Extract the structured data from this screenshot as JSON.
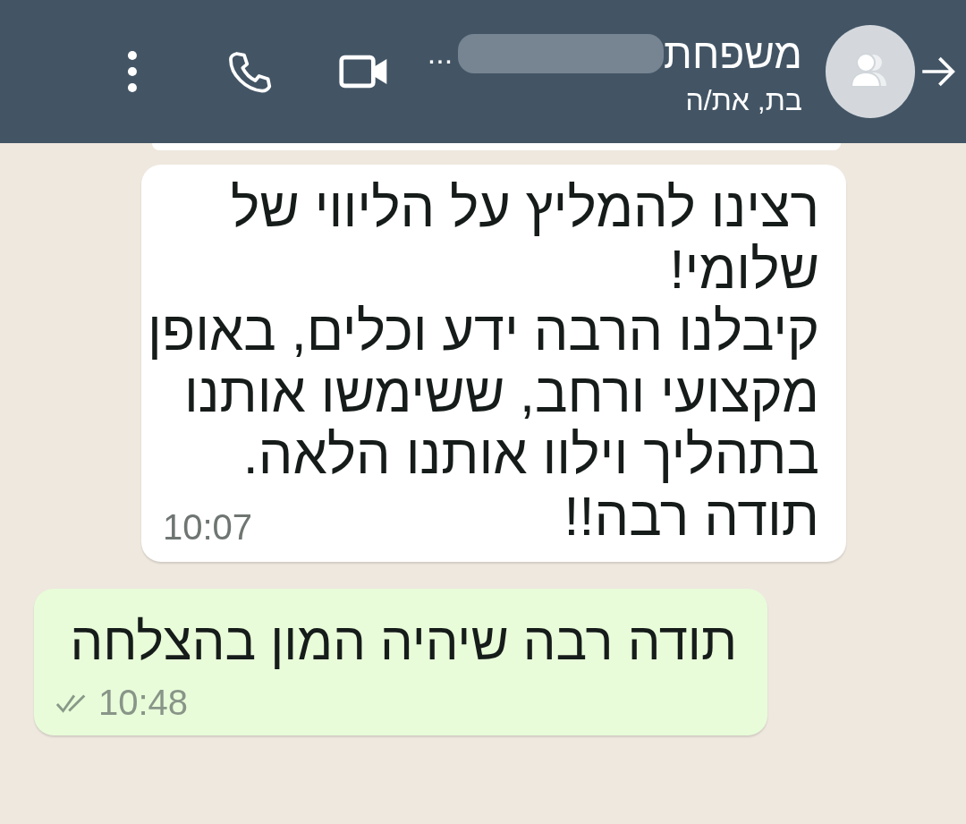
{
  "header": {
    "title": "משפחת",
    "title_ellipsis": "...",
    "subtitle": "בת, את/ה"
  },
  "messages": [
    {
      "kind": "incoming",
      "lines": [
        "רצינו להמליץ על הליווי של",
        "שלומי!",
        "קיבלנו הרבה ידע וכלים, באופן",
        "מקצועי ורחב, ששימשו אותנו",
        "בתהליך וילוו אותנו הלאה.",
        "תודה רבה!!"
      ],
      "time": "10:07"
    },
    {
      "kind": "outgoing",
      "lines": [
        "תודה רבה שיהיה המון בהצלחה"
      ],
      "time": "10:48",
      "read": false
    }
  ]
}
